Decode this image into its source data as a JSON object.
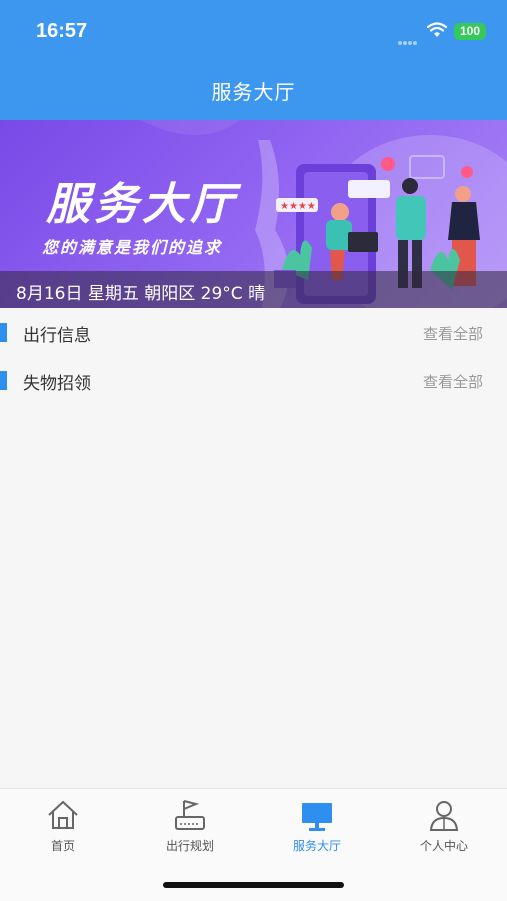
{
  "status_bar": {
    "time": "16:57",
    "battery": "100"
  },
  "nav": {
    "title": "服务大厅"
  },
  "banner": {
    "title": "服务大厅",
    "slogan": "您的满意是我们的追求",
    "caption": "8月16日 星期五 朝阳区 29°C 晴"
  },
  "sections": [
    {
      "title": "出行信息",
      "more": "查看全部"
    },
    {
      "title": "失物招领",
      "more": "查看全部"
    }
  ],
  "tabs": [
    {
      "label": "首页",
      "icon": "home-icon"
    },
    {
      "label": "出行规划",
      "icon": "flag-icon"
    },
    {
      "label": "服务大厅",
      "icon": "monitor-icon",
      "active": true
    },
    {
      "label": "个人中心",
      "icon": "user-icon"
    }
  ],
  "colors": {
    "primary": "#3d97ef",
    "accent": "#2f8ff0",
    "battery": "#35c85a"
  }
}
